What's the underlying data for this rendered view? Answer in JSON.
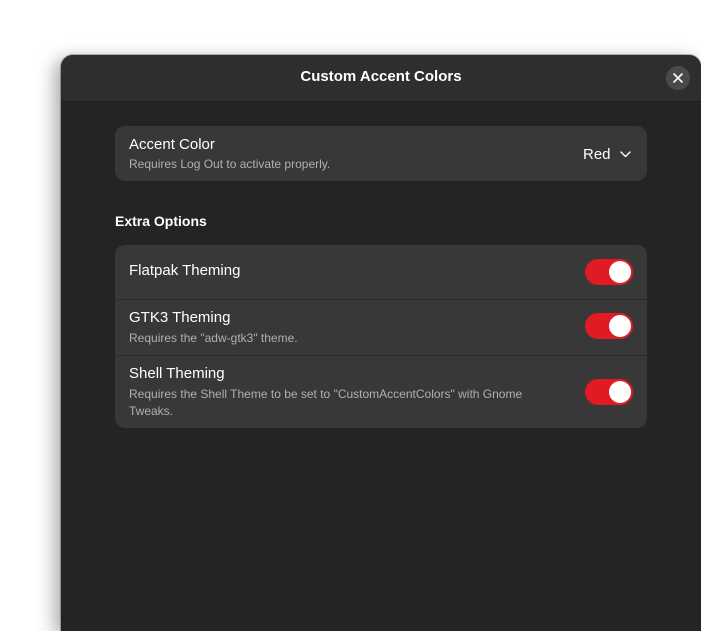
{
  "window": {
    "title": "Custom Accent Colors"
  },
  "accent": {
    "title": "Accent Color",
    "subtitle": "Requires Log Out to activate properly.",
    "selected": "Red"
  },
  "extra": {
    "heading": "Extra Options",
    "items": [
      {
        "title": "Flatpak Theming",
        "subtitle": "",
        "enabled": true
      },
      {
        "title": "GTK3 Theming",
        "subtitle": "Requires the \"adw-gtk3\" theme.",
        "enabled": true
      },
      {
        "title": "Shell Theming",
        "subtitle": "Requires the Shell Theme to be set to \"CustomAccentColors\" with Gnome Tweaks.",
        "enabled": true
      }
    ]
  },
  "colors": {
    "toggle_on": "#e01b24",
    "window_bg": "#242424",
    "card_bg": "#383838"
  },
  "icons": {
    "close": "close-icon",
    "dropdown": "chevron-down-icon"
  }
}
